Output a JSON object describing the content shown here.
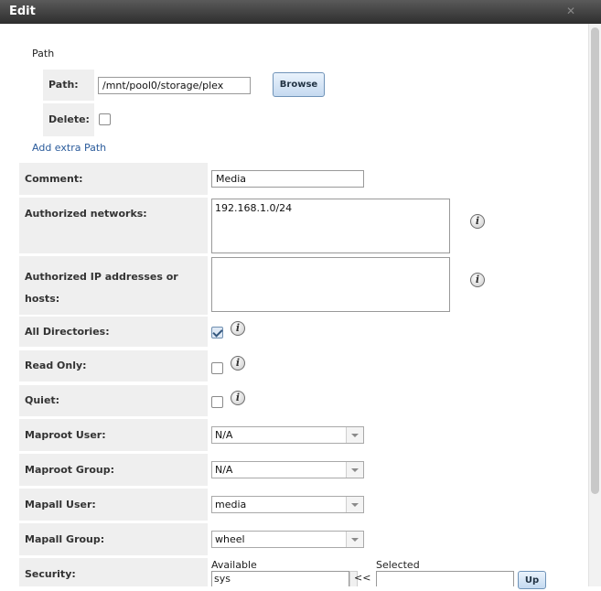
{
  "dialog": {
    "title": "Edit"
  },
  "path_section": {
    "legend": "Path",
    "path_label": "Path:",
    "path_value": "/mnt/pool0/storage/plex",
    "browse_label": "Browse",
    "delete_label": "Delete:",
    "delete_checked": false,
    "add_extra_label": "Add extra Path"
  },
  "form": {
    "comment": {
      "label": "Comment:",
      "value": "Media"
    },
    "authorized_networks": {
      "label": "Authorized networks:",
      "value": "192.168.1.0/24"
    },
    "authorized_ips": {
      "label_line1": "Authorized IP addresses or",
      "label_line2": "hosts:",
      "value": ""
    },
    "all_directories": {
      "label": "All Directories:",
      "checked": true
    },
    "read_only": {
      "label": "Read Only:",
      "checked": false
    },
    "quiet": {
      "label": "Quiet:",
      "checked": false
    },
    "maproot_user": {
      "label": "Maproot User:",
      "value": "N/A"
    },
    "maproot_group": {
      "label": "Maproot Group:",
      "value": "N/A"
    },
    "mapall_user": {
      "label": "Mapall User:",
      "value": "media"
    },
    "mapall_group": {
      "label": "Mapall Group:",
      "value": "wheel"
    },
    "security": {
      "label": "Security:",
      "available_label": "Available",
      "available_items": [
        "sys"
      ],
      "move_left_label": "<<",
      "selected_label": "Selected",
      "up_label": "Up"
    }
  },
  "icons": {
    "info": "info-icon",
    "close": "close-icon",
    "dropdown": "chevron-down-icon"
  }
}
